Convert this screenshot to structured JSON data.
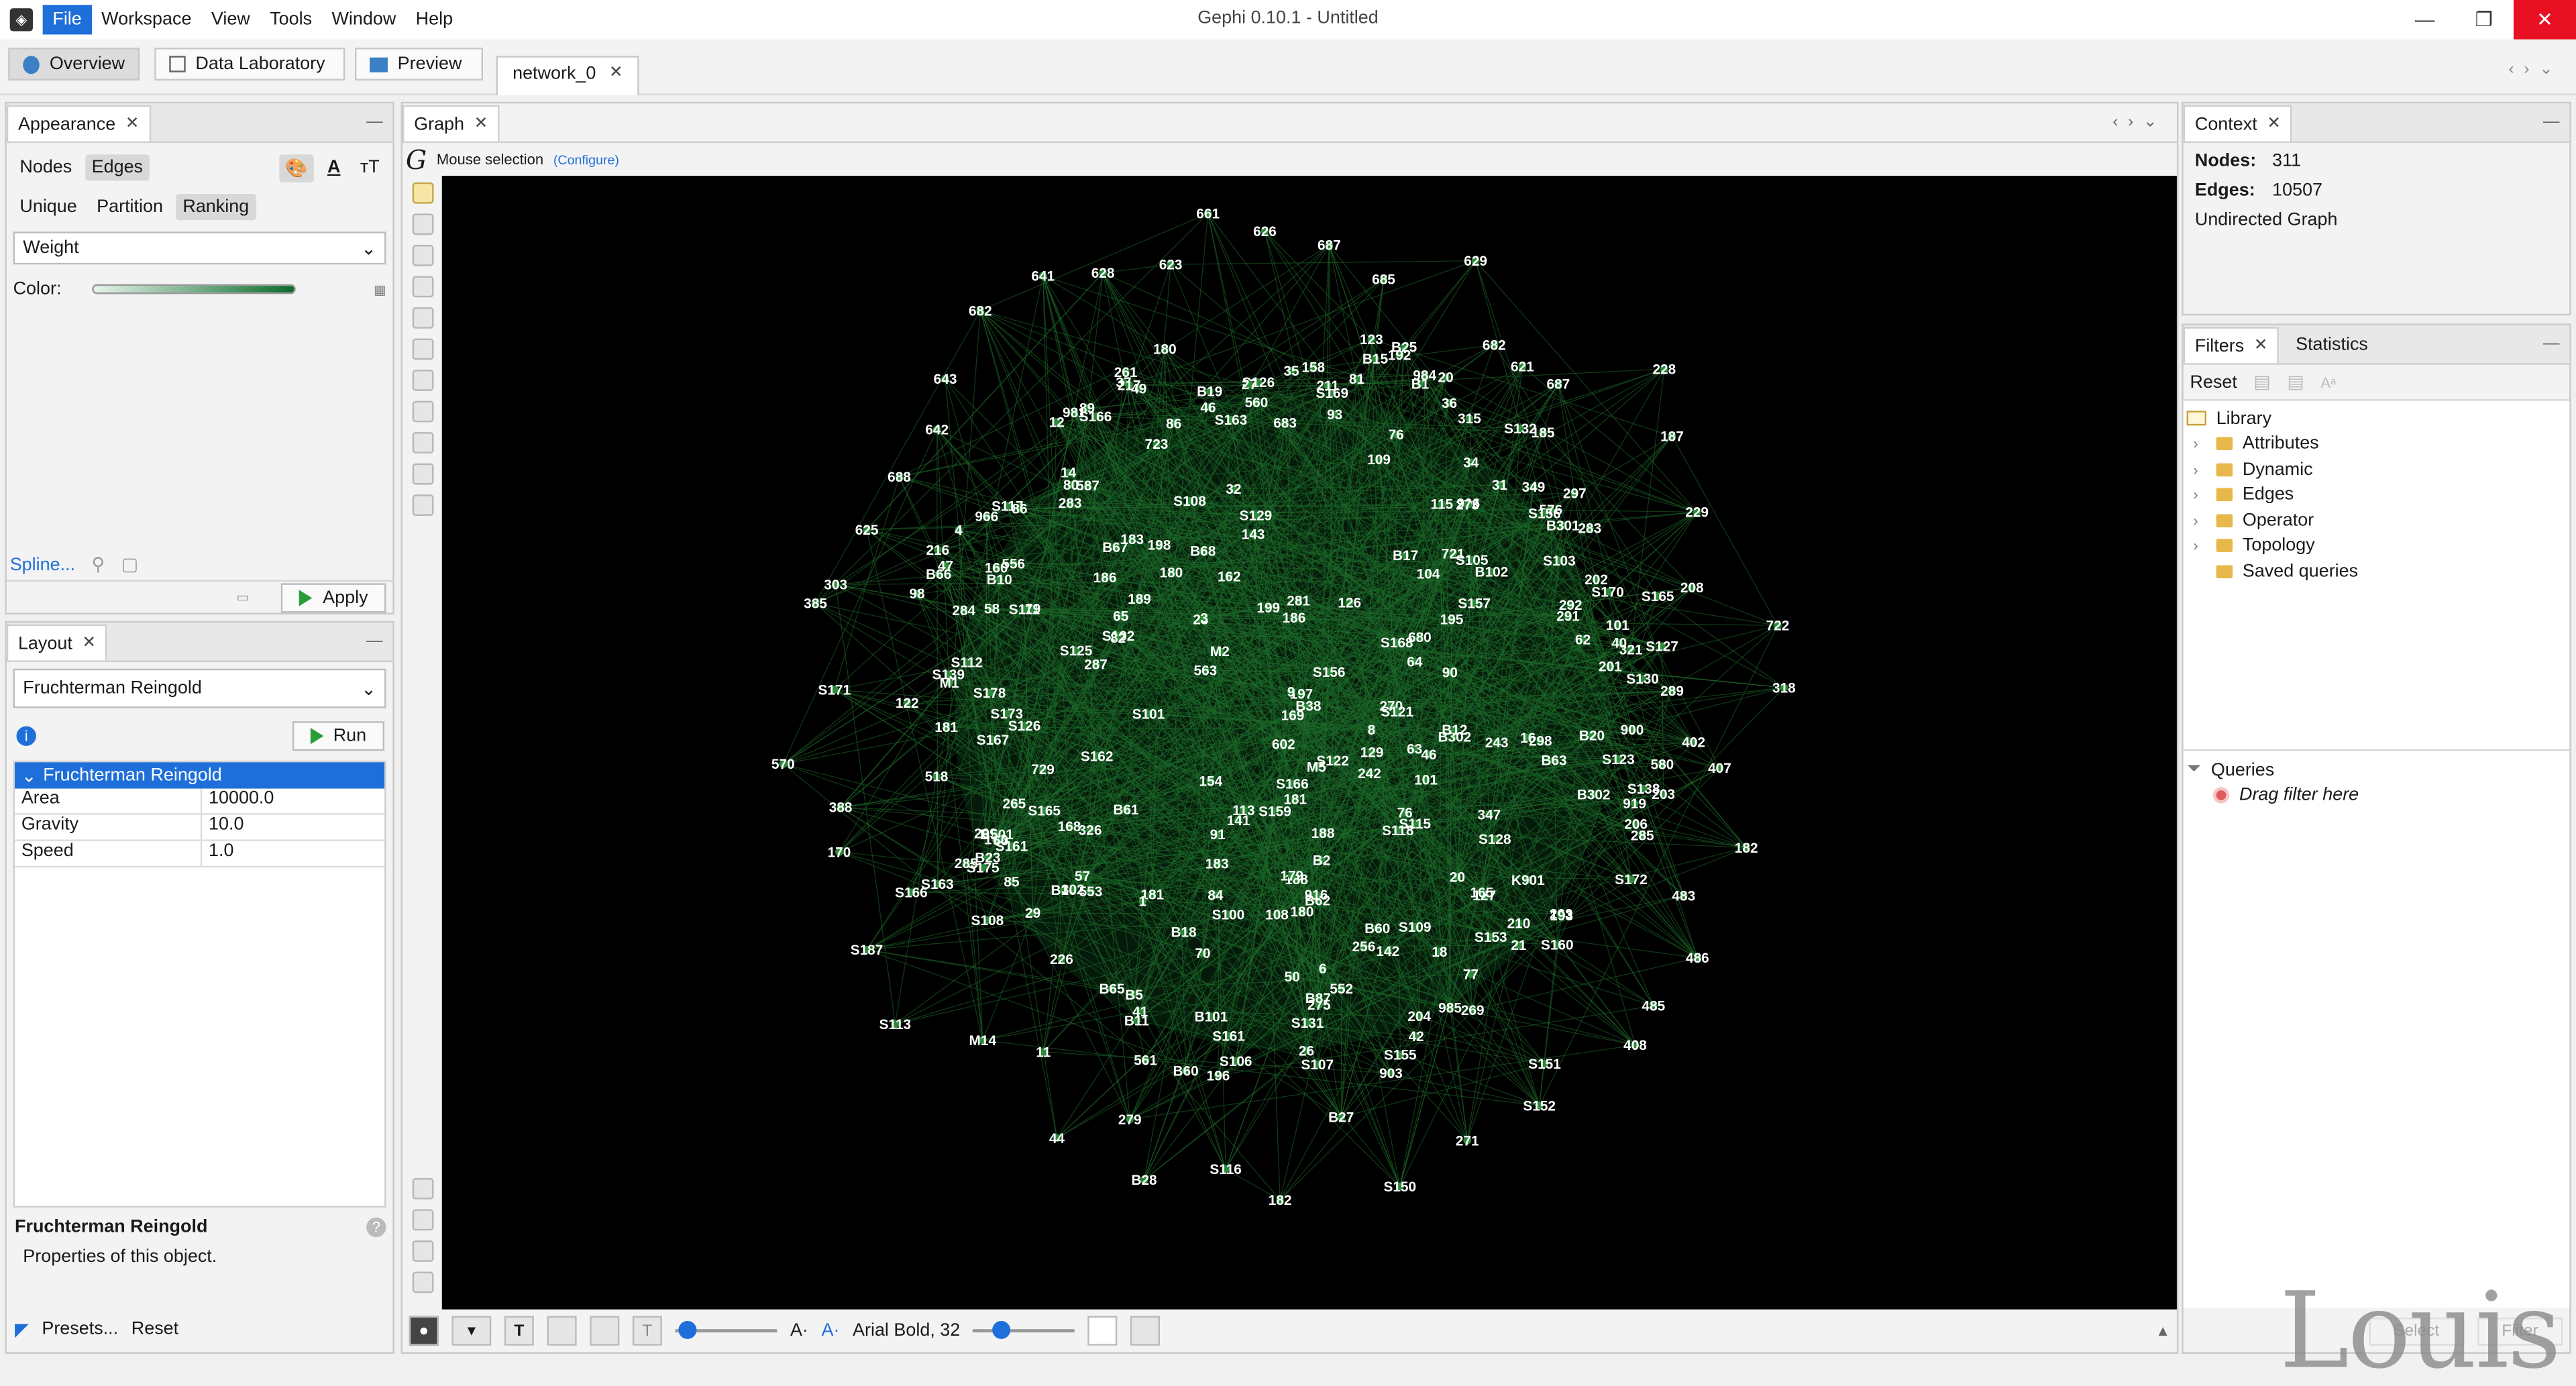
{
  "window": {
    "title": "Gephi 0.10.1 - Untitled",
    "menu": [
      "File",
      "Workspace",
      "View",
      "Tools",
      "Window",
      "Help"
    ]
  },
  "toolbar": {
    "overview": "Overview",
    "data_lab": "Data Laboratory",
    "preview": "Preview",
    "doc_tab": "network_0"
  },
  "appearance": {
    "tab": "Appearance",
    "subtabs": [
      "Nodes",
      "Edges"
    ],
    "modes": [
      "Unique",
      "Partition",
      "Ranking"
    ],
    "attribute": "Weight",
    "color_label": "Color:",
    "spline": "Spline...",
    "apply": "Apply"
  },
  "layout": {
    "tab": "Layout",
    "algorithm": "Fruchterman Reingold",
    "run": "Run",
    "props_title": "Fruchterman Reingold",
    "props": [
      {
        "k": "Area",
        "v": "10000.0"
      },
      {
        "k": "Gravity",
        "v": "10.0"
      },
      {
        "k": "Speed",
        "v": "1.0"
      }
    ],
    "desc_title": "Fruchterman Reingold",
    "desc_text": "Properties of this object.",
    "presets": "Presets...",
    "reset": "Reset"
  },
  "graph": {
    "tab": "Graph",
    "mouse_selection": "Mouse selection",
    "configure": "(Configure)",
    "font_label": "Arial Bold, 32",
    "node_color": "#2c8a3a",
    "edge_color": "#1d6b2a",
    "labels": [
      "402",
      "407",
      "182",
      "483",
      "486",
      "485",
      "408",
      "S151",
      "S152",
      "271",
      "S150",
      "B27",
      "182",
      "S116",
      "B28",
      "279",
      "44",
      "11",
      "M14",
      "S113",
      "S187",
      "S166",
      "170",
      "388",
      "570",
      "S171",
      "385",
      "303",
      "625",
      "688",
      "642",
      "643",
      "682",
      "641",
      "628",
      "623",
      "661",
      "626",
      "687",
      "685",
      "629",
      "682",
      "621",
      "687",
      "228",
      "187",
      "229",
      "208",
      "722",
      "318",
      "S161",
      "602",
      "270",
      "275",
      "181",
      "S131",
      "S107",
      "S105",
      "S101",
      "197",
      "S103",
      "S156",
      "90",
      "723",
      "B62",
      "S102",
      "186",
      "B19",
      "B63",
      "S168",
      "162",
      "S138",
      "S132",
      "S165",
      "S175",
      "S129",
      "S108",
      "B61",
      "B66",
      "B67",
      "B65",
      "B23",
      "183",
      "289",
      "31",
      "S155",
      "S153",
      "S111",
      "S170",
      "142",
      "S109",
      "S112",
      "S178",
      "226",
      "S123",
      "S125",
      "143",
      "180",
      "176",
      "281",
      "283",
      "261",
      "580",
      "S117",
      "576",
      "S122",
      "242",
      "S121",
      "292",
      "S118",
      "B68",
      "S162",
      "S163",
      "S169",
      "168",
      "181",
      "321",
      "680",
      "127",
      "189",
      "101",
      "198",
      "S167",
      "S172",
      "B18",
      "B38",
      "S128",
      "195",
      "158",
      "115",
      "B25",
      "160",
      "326",
      "S173",
      "S163",
      "14",
      "349",
      "S130",
      "S126",
      "S127",
      "347",
      "721",
      "S126",
      "123",
      "188",
      "263",
      "192",
      "46",
      "265",
      "47",
      "S106",
      "209",
      "B60",
      "B87",
      "20",
      "S108",
      "S160",
      "S157",
      "169",
      "16",
      "S156",
      "B2",
      "180",
      "76",
      "B20",
      "966",
      "21",
      "32",
      "98",
      "93",
      "27",
      "K901",
      "M2",
      "65",
      "916",
      "80",
      "26",
      "206",
      "85",
      "S166",
      "193",
      "122",
      "285",
      "B15",
      "B301",
      "42",
      "77",
      "64",
      "285",
      "S159",
      "185",
      "196",
      "B302",
      "79",
      "91",
      "6",
      "8",
      "28",
      "109",
      "M1",
      "29",
      "62",
      "101",
      "86",
      "985",
      "199",
      "B501",
      "B16",
      "165",
      "129",
      "181",
      "180",
      "63",
      "9",
      "919",
      "41",
      "B102",
      "900",
      "903",
      "60",
      "M5",
      "35",
      "B17",
      "B11",
      "70",
      "104",
      "37",
      "906",
      "B1",
      "40",
      "B101",
      "B5",
      "269",
      "89",
      "518",
      "36",
      "S166",
      "B12",
      "76",
      "34",
      "984",
      "82",
      "57",
      "683",
      "302",
      "50",
      "211",
      "108",
      "58",
      "216",
      "186",
      "587",
      "18",
      "S115",
      "183",
      "12",
      "1",
      "20",
      "46",
      "553",
      "3",
      "729",
      "126",
      "84",
      "188",
      "256",
      "556",
      "81",
      "273",
      "210",
      "560",
      "4",
      "B60",
      "203",
      "141",
      "297",
      "284",
      "287",
      "204",
      "49",
      "291",
      "243",
      "S139",
      "86",
      "B302",
      "201",
      "217",
      "552",
      "B10",
      "298",
      "981",
      "561",
      "202",
      "283",
      "179",
      "S165",
      "563",
      "315",
      "113",
      "S161",
      "S100",
      "154"
    ]
  },
  "context": {
    "tab": "Context",
    "nodes_label": "Nodes:",
    "nodes": "311",
    "edges_label": "Edges:",
    "edges": "10507",
    "graph_type": "Undirected Graph"
  },
  "filters": {
    "tab": "Filters",
    "stats_tab": "Statistics",
    "reset": "Reset",
    "library": "Library",
    "items": [
      "Attributes",
      "Dynamic",
      "Edges",
      "Operator",
      "Topology",
      "Saved queries"
    ],
    "queries": "Queries",
    "drag": "Drag filter here",
    "select": "Select",
    "filter": "Filter"
  },
  "watermark": "Louis"
}
